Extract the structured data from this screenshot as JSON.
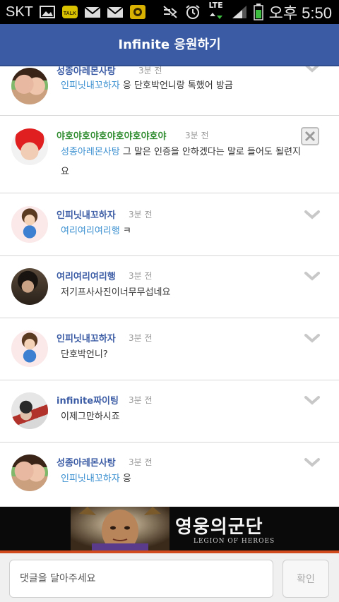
{
  "status_bar": {
    "carrier": "SKT",
    "network": "LTE",
    "clock": "오후 5:50",
    "icons": [
      "image-icon",
      "kakaotalk-icon",
      "mail-icon",
      "mail-icon",
      "coin-app-icon",
      "mute-icon",
      "alarm-icon",
      "lte-data-icon",
      "signal-icon",
      "battery-icon"
    ]
  },
  "header": {
    "title": "Infinite 응원하기"
  },
  "comments": [
    {
      "author": "성종아레몬사탕",
      "time": "3분 전",
      "mention": "인피닛내꼬하자",
      "text": " 응 단호박언니랑 톡했어 방금",
      "action": "chevron"
    },
    {
      "author": "야호야호야호야호야호야호야",
      "time": "3분 전",
      "mention": "성종아레몬사탕",
      "text": " 그 말은 인증을 안하겠다는 말로 들어도 될련지요",
      "action": "close"
    },
    {
      "author": "인피닛내꼬하자",
      "time": "3분 전",
      "mention": "여리여리여리행",
      "text": " ㅋ",
      "action": "chevron"
    },
    {
      "author": "여리여리여리행",
      "time": "3분 전",
      "mention": "",
      "text": "저기프사사진이너무무섭네요",
      "action": "chevron"
    },
    {
      "author": "인피닛내꼬하자",
      "time": "3분 전",
      "mention": "",
      "text": "단호박언니?",
      "action": "chevron"
    },
    {
      "author": "infinite짜이팅",
      "time": "3분 전",
      "mention": "",
      "text": "이제그만하시죠",
      "action": "chevron"
    },
    {
      "author": "성종아레몬사탕",
      "time": "3분 전",
      "mention": "인피닛내꼬하자",
      "text": " 응",
      "action": "chevron"
    }
  ],
  "banner": {
    "title": "영웅의군단",
    "subtitle": "LEGION OF HEROES"
  },
  "input": {
    "placeholder": "댓글을 달아주세요",
    "confirm_label": "확인"
  },
  "colors": {
    "header": "#3b5ca5",
    "author": "#3b5ca5",
    "author_highlight": "#2e8b2e",
    "mention": "#3a8fd0",
    "banner_accent": "#d04a1e"
  }
}
